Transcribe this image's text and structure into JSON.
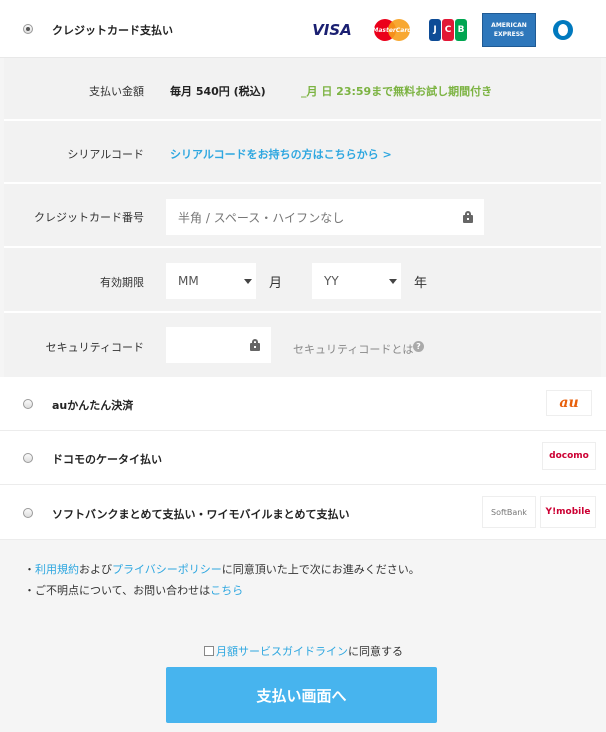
{
  "credit_card_option": {
    "label": "クレジットカード支払い",
    "selected": true,
    "brands": [
      "VISA",
      "MasterCard",
      "JCB",
      "AMERICAN EXPRESS",
      "Diners Club"
    ]
  },
  "form": {
    "amount": {
      "label": "支払い金額",
      "value": "毎月 540円 (税込)",
      "trial_note": "_月 日 23:59まで無料お試し期間付き"
    },
    "serial": {
      "label": "シリアルコード",
      "link": "シリアルコードをお持ちの方はこちらから >"
    },
    "card_number": {
      "label": "クレジットカード番号",
      "placeholder": "半角 / スペース・ハイフンなし"
    },
    "expiry": {
      "label": "有効期限",
      "month_value": "MM",
      "month_unit": "月",
      "year_value": "YY",
      "year_unit": "年"
    },
    "security": {
      "label": "セキュリティコード",
      "help": "セキュリティコードとは",
      "help_icon": "?"
    }
  },
  "other_options": [
    {
      "label": "auかんたん決済",
      "logo_text": "au"
    },
    {
      "label": "ドコモのケータイ払い",
      "logo_text": "docomo"
    },
    {
      "label": "ソフトバンクまとめて支払い・ワイモバイルまとめて支払い",
      "logo_text": "SoftBank",
      "logo_text2": "Y!mobile"
    }
  ],
  "notes": {
    "line1_bullet": "・",
    "line1_link1": "利用規約",
    "line1_mid": "および",
    "line1_link2": "プライバシーポリシー",
    "line1_tail": "に同意頂いた上で次にお進みください。",
    "line2_text": "・ご不明点について、お問い合わせは",
    "line2_link": "こちら"
  },
  "agreement": {
    "link": "月額サービスガイドライン",
    "tail": "に同意する",
    "checked": false
  },
  "submit_label": "支払い画面へ",
  "colors": {
    "link": "#2ea7e0",
    "trial": "#7cb342",
    "button": "#47b4ee"
  }
}
